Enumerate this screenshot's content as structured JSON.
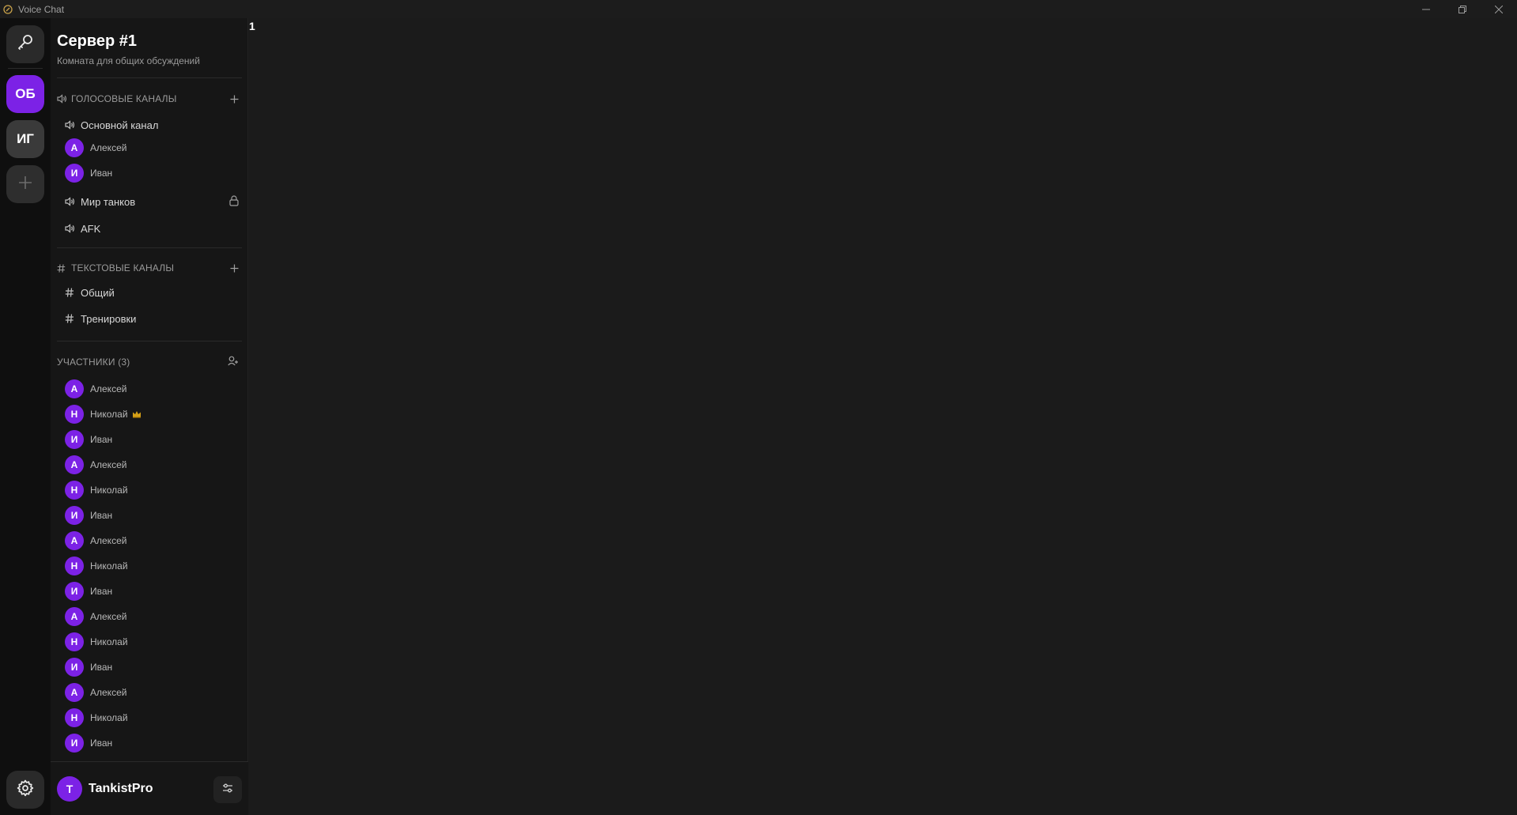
{
  "window": {
    "title": "Voice Chat"
  },
  "colors": {
    "accent": "#7c22e6",
    "rail_bg": "#0f0f0f",
    "sidebar_bg": "#161616",
    "main_bg": "#1b1b1b"
  },
  "rail": {
    "app_icon": "microphone-icon",
    "servers": [
      {
        "initials": "ОБ",
        "active": true
      },
      {
        "initials": "ИГ",
        "active": false
      }
    ],
    "add_icon": "plus-icon",
    "settings_icon": "gear-icon"
  },
  "server": {
    "title": "Сервер #1",
    "subtitle": "Комната для общих обсуждений"
  },
  "voice": {
    "header": "ГОЛОСОВЫЕ КАНАЛЫ",
    "channels": [
      {
        "name": "Основной канал",
        "users": [
          {
            "initial": "А",
            "name": "Алексей"
          },
          {
            "initial": "И",
            "name": "Иван"
          }
        ]
      },
      {
        "name": "Мир танков",
        "locked": true
      },
      {
        "name": "AFK"
      }
    ]
  },
  "text": {
    "header": "ТЕКСТОВЫЕ КАНАЛЫ",
    "channels": [
      {
        "name": "Общий"
      },
      {
        "name": "Тренировки"
      }
    ]
  },
  "members": {
    "header": "УЧАСТНИКИ (3)",
    "list": [
      {
        "initial": "А",
        "name": "Алексей"
      },
      {
        "initial": "Н",
        "name": "Николай",
        "owner": true
      },
      {
        "initial": "И",
        "name": "Иван"
      },
      {
        "initial": "А",
        "name": "Алексей"
      },
      {
        "initial": "Н",
        "name": "Николай"
      },
      {
        "initial": "И",
        "name": "Иван"
      },
      {
        "initial": "А",
        "name": "Алексей"
      },
      {
        "initial": "Н",
        "name": "Николай"
      },
      {
        "initial": "И",
        "name": "Иван"
      },
      {
        "initial": "А",
        "name": "Алексей"
      },
      {
        "initial": "Н",
        "name": "Николай"
      },
      {
        "initial": "И",
        "name": "Иван"
      },
      {
        "initial": "А",
        "name": "Алексей"
      },
      {
        "initial": "Н",
        "name": "Николай"
      },
      {
        "initial": "И",
        "name": "Иван"
      }
    ]
  },
  "user": {
    "initial": "T",
    "name": "TankistPro"
  },
  "main": {
    "badge": "1"
  }
}
